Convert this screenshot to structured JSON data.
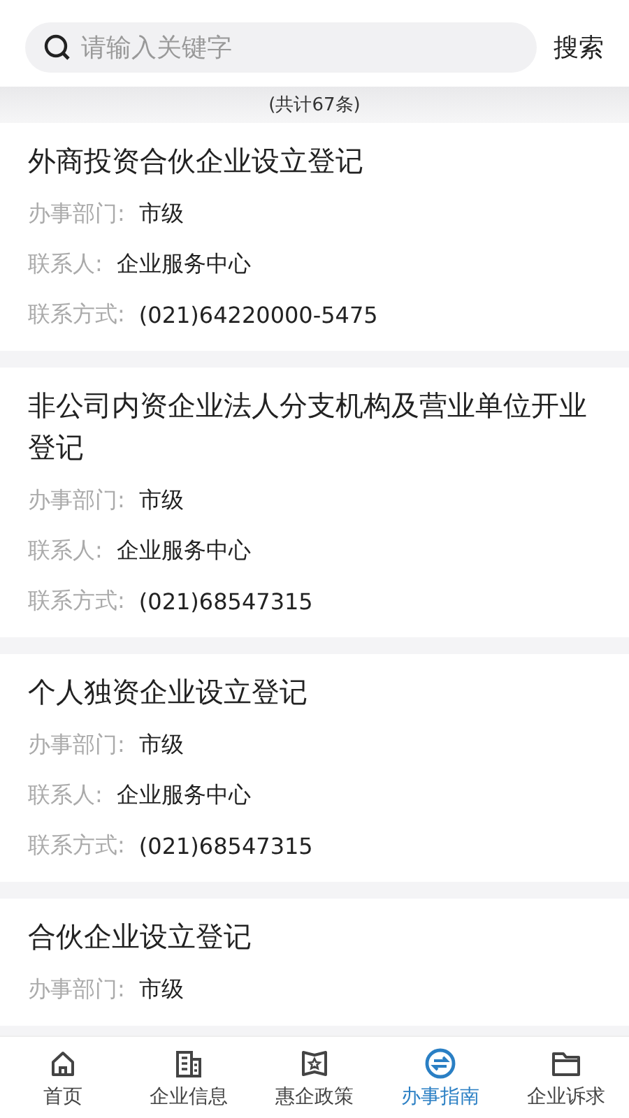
{
  "search": {
    "placeholder": "请输入关键字",
    "button": "搜索"
  },
  "count": "(共计67条)",
  "items": [
    {
      "title": "外商投资合伙企业设立登记",
      "fields": [
        {
          "label": "办事部门:",
          "value": "市级"
        },
        {
          "label": "联系人:",
          "value": "企业服务中心"
        },
        {
          "label": "联系方式:",
          "value": "(021)64220000-5475"
        }
      ]
    },
    {
      "title": "非公司内资企业法人分支机构及营业单位开业登记",
      "fields": [
        {
          "label": "办事部门:",
          "value": "市级"
        },
        {
          "label": "联系人:",
          "value": "企业服务中心"
        },
        {
          "label": "联系方式:",
          "value": "(021)68547315"
        }
      ]
    },
    {
      "title": "个人独资企业设立登记",
      "fields": [
        {
          "label": "办事部门:",
          "value": "市级"
        },
        {
          "label": "联系人:",
          "value": "企业服务中心"
        },
        {
          "label": "联系方式:",
          "value": "(021)68547315"
        }
      ]
    },
    {
      "title": "合伙企业设立登记",
      "fields": [
        {
          "label": "办事部门:",
          "value": "市级"
        }
      ]
    }
  ],
  "tabs": [
    {
      "label": "首页",
      "kind": "home",
      "selected": false
    },
    {
      "label": "企业信息",
      "kind": "building",
      "selected": false
    },
    {
      "label": "惠企政策",
      "kind": "policy",
      "selected": false
    },
    {
      "label": "办事指南",
      "kind": "guide",
      "selected": true
    },
    {
      "label": "企业诉求",
      "kind": "folder",
      "selected": false
    }
  ]
}
